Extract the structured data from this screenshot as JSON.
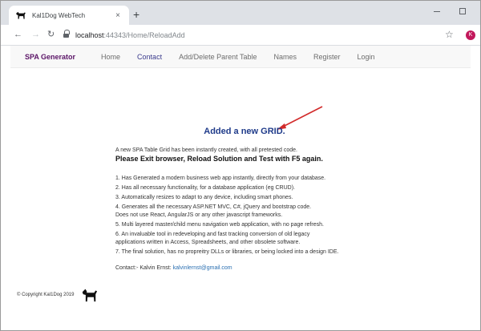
{
  "browser": {
    "tab_title": "Kal1Dog WebTech",
    "tab_close": "×",
    "new_tab": "+",
    "url_host": "localhost",
    "url_rest": ":44343/Home/ReloadAdd",
    "profile_initial": "K"
  },
  "navbar": {
    "brand": "SPA Generator",
    "links": [
      {
        "label": "Home"
      },
      {
        "label": "Contact"
      },
      {
        "label": "Add/Delete Parent Table"
      },
      {
        "label": "Names"
      },
      {
        "label": "Register"
      },
      {
        "label": "Login"
      }
    ],
    "active_index": 1
  },
  "main": {
    "heading": "Added a new GRID.",
    "intro": "A new SPA Table Grid has been instantly created, with all pretested code.",
    "intro_bold": "Please Exit browser, Reload Solution and Test with F5 again.",
    "items": [
      "1. Has Generated a modern business web app instantly, directly from your database.",
      "2. Has all necessary functionality, for a database application (eg CRUD).",
      "3. Automatically resizes to adapt to any device, including smart phones.",
      "4. Generates all the necessary ASP.NET MVC, C#, jQuery and bootstrap code.",
      "Does not use React, AngularJS or any other javascript frameworks.",
      "5. Multi layered master/child menu navigation web application, with no page refresh.",
      "6. An invaluable tool in redeveloping and fast tracking conversion of old legacy",
      "applications written in Access, Spreadsheets, and other obsolete software.",
      "7. The final solution, has no propreitry DLLs or libraries, or being locked into a design IDE."
    ],
    "contact_label": "Contact:- Kalvin Ernst:",
    "contact_email": "kalvinlernst@gmail.com"
  },
  "footer": {
    "copyright": "© Copyright Kal1Dog 2019"
  },
  "colors": {
    "brand": "#5b1567",
    "heading": "#1f3b8a",
    "link": "#2a6fb1",
    "arrow": "#d22b2b"
  }
}
